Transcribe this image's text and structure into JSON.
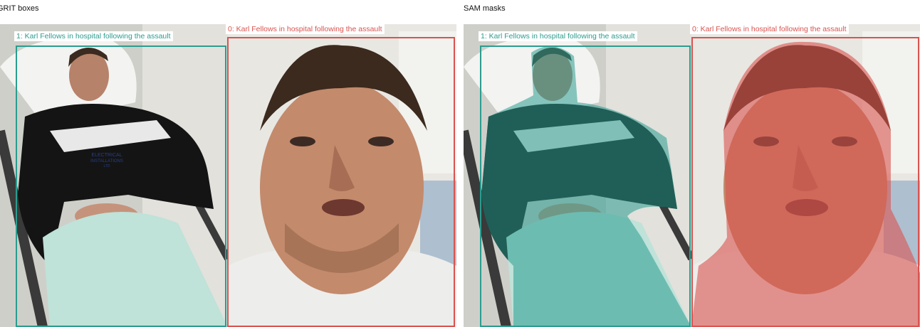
{
  "panels": [
    {
      "title": "GRIT boxes",
      "mode": "boxes",
      "detections": [
        {
          "label": "1: Karl Fellows in hospital following the assault",
          "color": "#2a9d8f"
        },
        {
          "label": "0: Karl Fellows in hospital following the assault",
          "color": "#d9534f"
        }
      ]
    },
    {
      "title": "SAM masks",
      "mode": "masks",
      "detections": [
        {
          "label": "1: Karl Fellows in hospital following the assault",
          "color": "#2a9d8f"
        },
        {
          "label": "0: Karl Fellows in hospital following the assault",
          "color": "#d9534f"
        }
      ]
    }
  ],
  "photo": {
    "logo_text": [
      "ELECTRICAL",
      "INSTALLATIONS",
      "LTD"
    ]
  }
}
